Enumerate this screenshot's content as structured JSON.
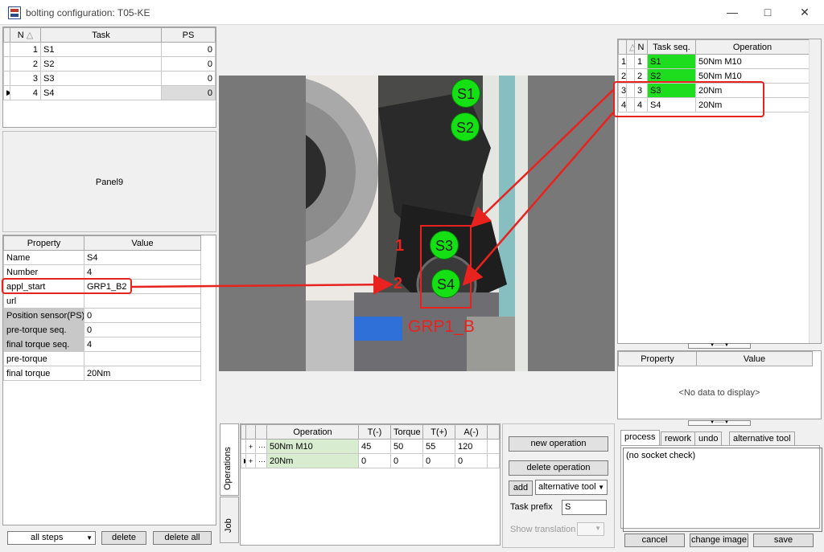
{
  "window": {
    "title": "bolting configuration:  T05-KE"
  },
  "steps": {
    "headers": {
      "n": "N",
      "task": "Task",
      "ps": "PS"
    },
    "rows": [
      {
        "n": "1",
        "task": "S1",
        "ps": "0"
      },
      {
        "n": "2",
        "task": "S2",
        "ps": "0"
      },
      {
        "n": "3",
        "task": "S3",
        "ps": "0"
      },
      {
        "n": "4",
        "task": "S4",
        "ps": "0"
      }
    ]
  },
  "panel9": {
    "label": "Panel9"
  },
  "properties": {
    "headers": {
      "property": "Property",
      "value": "Value"
    },
    "rows": [
      {
        "property": "Name",
        "value": "S4"
      },
      {
        "property": "Number",
        "value": "4"
      },
      {
        "property": "appl_start",
        "value": "GRP1_B2"
      },
      {
        "property": "url",
        "value": ""
      },
      {
        "property": "Position sensor(PS)",
        "value": "0"
      },
      {
        "property": "pre-torque seq.",
        "value": "0"
      },
      {
        "property": "final torque seq.",
        "value": "4"
      },
      {
        "property": "pre-torque",
        "value": ""
      },
      {
        "property": "final torque",
        "value": "20Nm"
      }
    ]
  },
  "bottom_left": {
    "filter": "all steps",
    "delete": "delete",
    "delete_all": "delete all"
  },
  "image": {
    "markers": [
      "S1",
      "S2",
      "S3",
      "S4"
    ],
    "labels": {
      "one": "1",
      "two": "2",
      "group": "GRP1_B"
    }
  },
  "operations": {
    "headers": {
      "operation": "Operation",
      "t_minus": "T(-)",
      "torque": "Torque",
      "t_plus": "T(+)",
      "a_minus": "A(-)"
    },
    "rows": [
      {
        "expand": "+",
        "dots": "···",
        "operation": "50Nm M10",
        "t_minus": "45",
        "torque": "50",
        "t_plus": "55",
        "a_minus": "120"
      },
      {
        "expand": "+",
        "dots": "···",
        "operation": "20Nm",
        "t_minus": "0",
        "torque": "0",
        "t_plus": "0",
        "a_minus": "0"
      }
    ],
    "side_tabs": {
      "operations": "Operations",
      "job": "Job"
    }
  },
  "op_controls": {
    "new_operation": "new operation",
    "delete_operation": "delete operation",
    "add": "add",
    "alternative_tool": "alternative tool",
    "task_prefix_label": "Task prefix",
    "task_prefix_value": "S",
    "show_translation": "Show translation"
  },
  "task_seq": {
    "headers": {
      "n": "N",
      "task_seq": "Task seq.",
      "operation": "Operation"
    },
    "rows": [
      {
        "idx": "1",
        "n": "1",
        "task": "S1",
        "operation": "50Nm M10"
      },
      {
        "idx": "2",
        "n": "2",
        "task": "S2",
        "operation": "50Nm M10"
      },
      {
        "idx": "3",
        "n": "3",
        "task": "S3",
        "operation": "20Nm"
      },
      {
        "idx": "4",
        "n": "4",
        "task": "S4",
        "operation": "20Nm"
      }
    ]
  },
  "right_props": {
    "headers": {
      "property": "Property",
      "value": "Value"
    },
    "empty": "<No data to display>"
  },
  "right_tabs": {
    "process": "process",
    "rework": "rework",
    "undo": "undo",
    "alternative_tool": "alternative tool"
  },
  "memo": {
    "text": "(no socket check)"
  },
  "footer": {
    "cancel": "cancel",
    "change_image": "change image",
    "save": "save"
  },
  "colors": {
    "marker_green": "#1edc1e",
    "annotation_red": "#e8231f"
  }
}
